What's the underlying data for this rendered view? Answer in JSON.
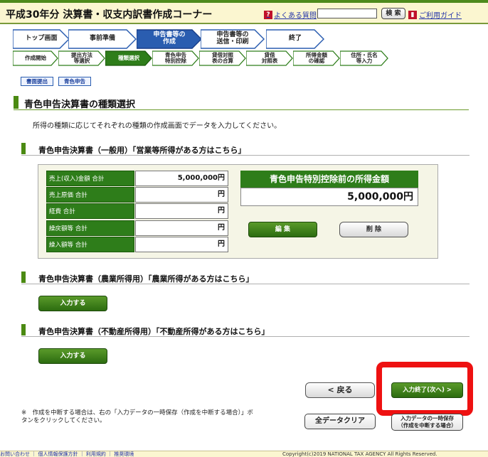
{
  "header": {
    "title": "平成30年分 決算書・収支内訳書作成コーナー",
    "faq_label": "よくある質問",
    "faq_icon": "?",
    "search_label": "検 索",
    "search_placeholder": "",
    "guide_label": "ご利用ガイド"
  },
  "steps_main": [
    {
      "label": "トップ画面",
      "active": false
    },
    {
      "label": "事前準備",
      "active": false
    },
    {
      "label": "申告書等の\n作成",
      "active": true
    },
    {
      "label": "申告書等の\n送信・印刷",
      "active": false
    },
    {
      "label": "終了",
      "active": false
    }
  ],
  "steps_sub": [
    {
      "label": "作成開始",
      "active": false
    },
    {
      "label": "提出方法\n等選択",
      "active": false
    },
    {
      "label": "種類選択",
      "active": true
    },
    {
      "label": "青色申告\n特別控除",
      "active": false
    },
    {
      "label": "貸借対照\n表の合算",
      "active": false
    },
    {
      "label": "貸借\n対照表",
      "active": false
    },
    {
      "label": "所得金額\nの確認",
      "active": false
    },
    {
      "label": "住所・氏名\n等入力",
      "active": false
    }
  ],
  "tags": {
    "submit": "書面提出",
    "blue": "青色申告"
  },
  "page_title": "青色申告決算書の種類選択",
  "description": "所得の種類に応じてそれぞれの種類の作成画面でデータを入力してください。",
  "section_general": {
    "title": "青色申告決算書（一般用）「営業等所得がある方はこちら」",
    "rows": [
      {
        "label": "売上(収入)金額 合計",
        "value": "5,000,000円"
      },
      {
        "label": "売上原価 合計",
        "value": "円"
      },
      {
        "label": "経費 合計",
        "value": "円"
      },
      {
        "label": "繰戻額等 合計",
        "value": "円"
      },
      {
        "label": "繰入額等 合計",
        "value": "円"
      }
    ],
    "income_title": "青色申告特別控除前の所得金額",
    "income_value": "5,000,000円",
    "edit_label": "編 集",
    "delete_label": "削 除"
  },
  "section_agri": {
    "title": "青色申告決算書（農業所得用）「農業所得がある方はこちら」",
    "input_label": "入力する"
  },
  "section_real": {
    "title": "青色申告決算書（不動産所得用）「不動産所得がある方はこちら」",
    "input_label": "入力する"
  },
  "nav": {
    "back_label": "< 戻る",
    "next_label": "入力終了(次へ) >"
  },
  "note": "※　作成を中断する場合は、右の「入力データの一時保存（作成を中断する場合）」ボタンをクリックしてください。",
  "clear_label": "全データクリア",
  "temp_save_label": "入力データの一時保存\n（作成を中断する場合）",
  "footer": {
    "links": "お問い合わせ ｜ 個人情報保護方針 ｜ 利用規約 ｜ 推奨環境",
    "copyright": "Copyright(c)2019 NATIONAL TAX AGENCY All Rights Reserved."
  },
  "colors": {
    "accent_green": "#2e7d1a",
    "step_blue": "#2a5db0",
    "highlight": "#ee1111"
  }
}
